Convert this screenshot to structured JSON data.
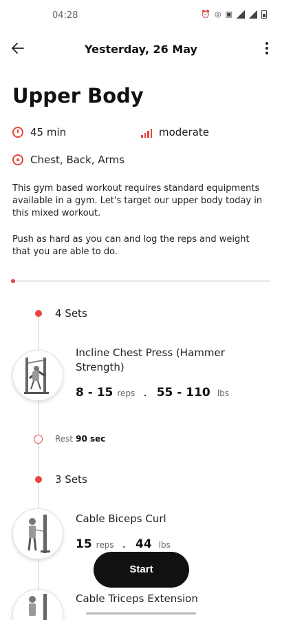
{
  "status_bar": {
    "time": "04:28",
    "icons": [
      "alarm-icon",
      "hotspot-icon",
      "volte-icon",
      "signal-icon",
      "battery-icon"
    ]
  },
  "app_bar": {
    "back_icon": "arrow-left-icon",
    "title": "Yesterday, 26 May",
    "more_icon": "more-vertical-icon"
  },
  "workout": {
    "title": "Upper Body",
    "duration": "45 min",
    "intensity": "moderate",
    "muscles": "Chest, Back, Arms",
    "description": [
      "This gym based workout requires standard equipments available in a gym. Let's target our upper body today in this mixed workout.",
      "Push as hard as you can and log the reps and weight that you are able to do."
    ],
    "progress": 0
  },
  "blocks": [
    {
      "sets_label": "4 Sets",
      "exercise": "Incline Chest Press (Hammer Strength)",
      "reps": "8 - 15",
      "reps_unit": "reps",
      "weight": "55 - 110",
      "weight_unit": "lbs",
      "rest_label": "Rest",
      "rest_value": "90 sec"
    },
    {
      "sets_label": "3 Sets",
      "exercise": "Cable Biceps Curl",
      "reps": "15",
      "reps_unit": "reps",
      "weight": "44",
      "weight_unit": "lbs"
    },
    {
      "exercise": "Cable Triceps Extension"
    }
  ],
  "start_button": "Start",
  "colors": {
    "accent": "#e8453c",
    "button": "#111111"
  }
}
